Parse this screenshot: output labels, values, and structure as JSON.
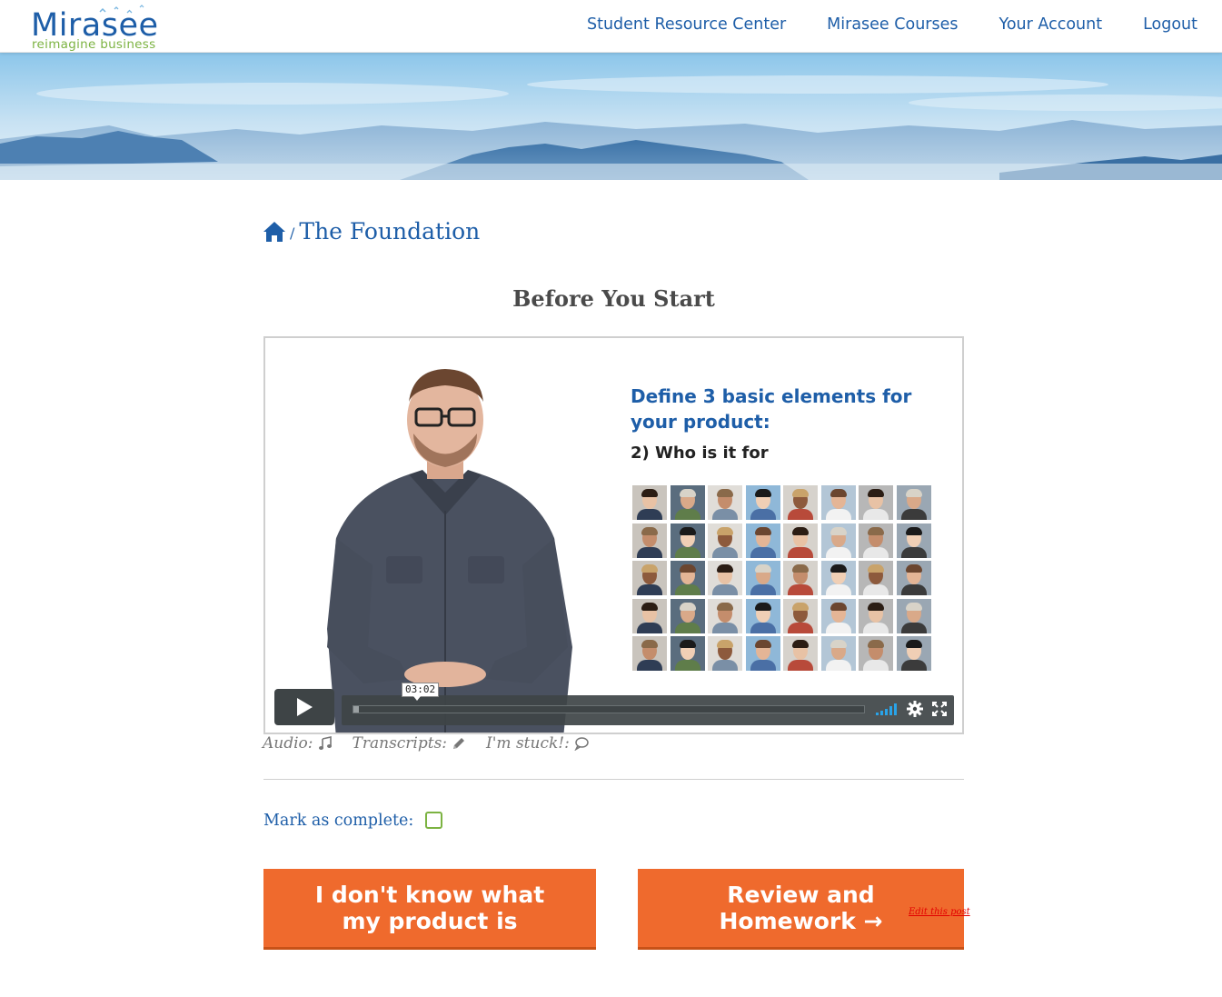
{
  "header": {
    "logo_name": "Mirasee",
    "logo_tagline": "reimagine business",
    "nav": [
      {
        "label": "Student Resource Center"
      },
      {
        "label": "Mirasee Courses"
      },
      {
        "label": "Your Account"
      },
      {
        "label": "Logout"
      }
    ]
  },
  "breadcrumb": {
    "separator": "/",
    "current": "The Foundation"
  },
  "page_title": "Before You Start",
  "video": {
    "slide_title": "Define 3 basic elements for your product:",
    "slide_subtitle": "2) Who is it for",
    "time_tooltip": "03:02",
    "progress": 0.01
  },
  "resources": {
    "audio_label": "Audio:",
    "transcripts_label": "Transcripts:",
    "stuck_label": "I'm stuck!:"
  },
  "mark_complete_label": "Mark as complete:",
  "buttons": {
    "left_label": "I don't know what my product is",
    "right_label": "Review and Homework →"
  },
  "edit_post_label": "Edit this post",
  "colors": {
    "brand_blue": "#1e5ea8",
    "brand_green": "#7cb342",
    "button_orange": "#ef6a2d"
  }
}
